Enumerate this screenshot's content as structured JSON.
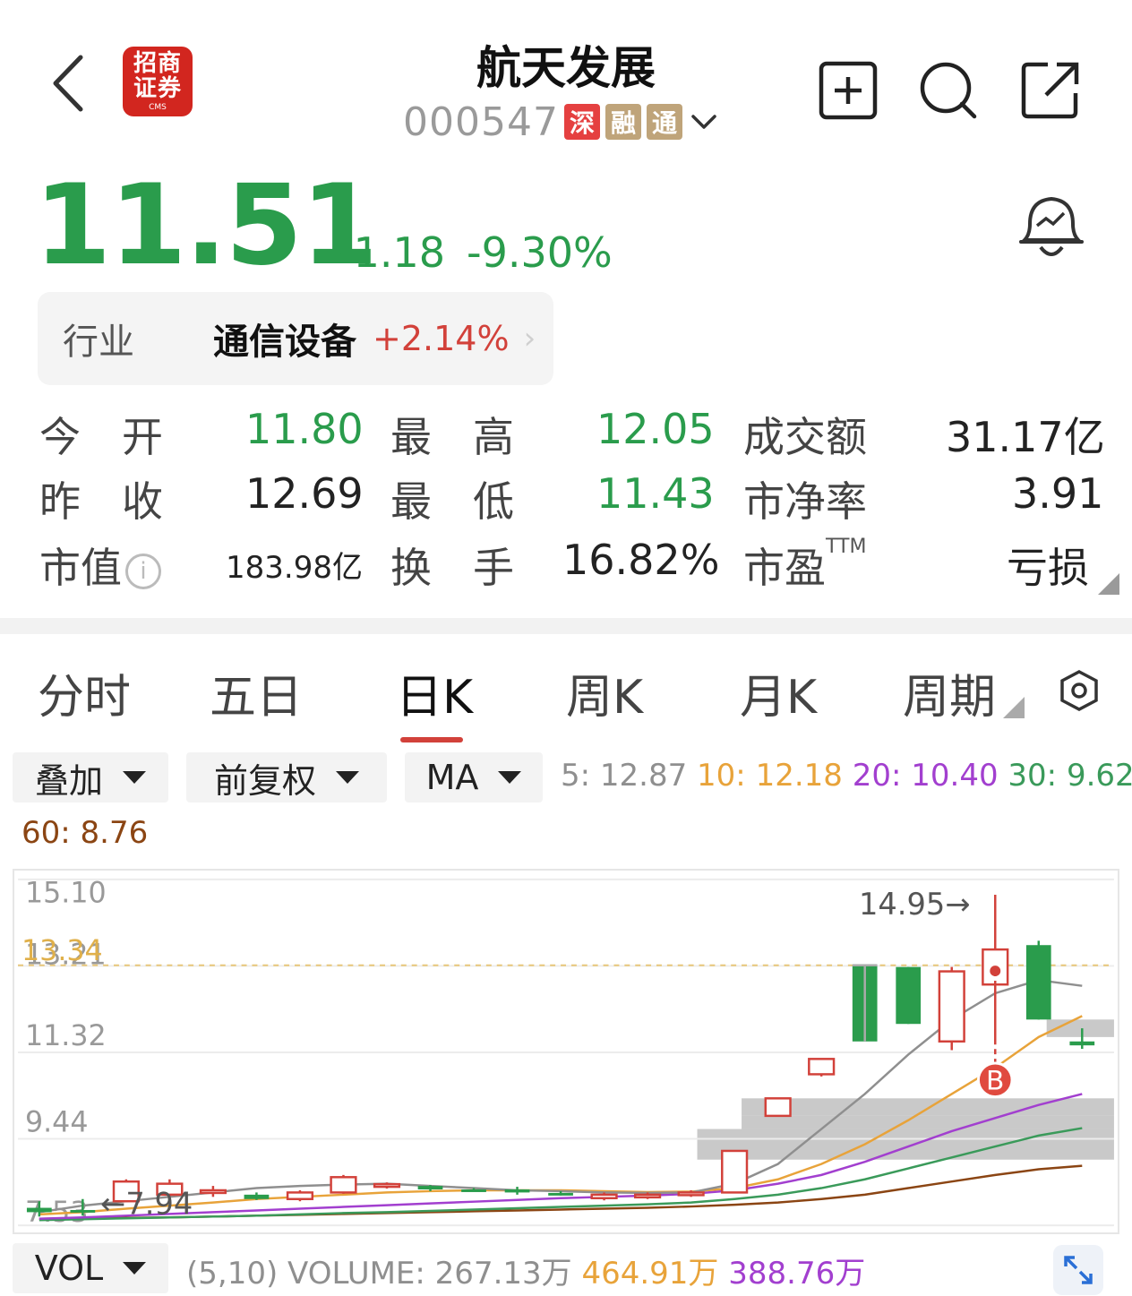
{
  "header": {
    "broker_logo_text": [
      "招商",
      "证券",
      "CMS"
    ],
    "stock_name": "航天发展",
    "stock_code": "000547",
    "badges": [
      "深",
      "融",
      "通"
    ]
  },
  "quote": {
    "price": "11.51",
    "change": "-1.18",
    "change_pct": "-9.30%"
  },
  "industry": {
    "label": "行业",
    "name": "通信设备",
    "change_pct": "+2.14%"
  },
  "stats": {
    "open_label": "今　开",
    "open": "11.80",
    "high_label": "最　高",
    "high": "12.05",
    "turnover_amt_label": "成交额",
    "turnover_amt": "31.17亿",
    "prev_close_label": "昨　收",
    "prev_close": "12.69",
    "low_label": "最　低",
    "low": "11.43",
    "pb_label": "市净率",
    "pb": "3.91",
    "mcap_label": "市值",
    "mcap": "183.98亿",
    "turnover_label": "换　手",
    "turnover": "16.82%",
    "pe_label": "市盈",
    "pe_sup": "TTM",
    "pe": "亏损"
  },
  "tabs": [
    "分时",
    "五日",
    "日K",
    "周K",
    "月K",
    "周期"
  ],
  "active_tab": "日K",
  "selectors": {
    "overlay": "叠加",
    "adjust": "前复权",
    "indicator": "MA",
    "vol": "VOL"
  },
  "ma": {
    "ma5": "5: 12.87",
    "ma10": "10: 12.18",
    "ma20": "20: 10.40",
    "ma30": "30: 9.62",
    "ma60": "60: 8.76"
  },
  "colors": {
    "up": "#d2413a",
    "down": "#2a9c4c",
    "ma5": "#8f8f8f",
    "ma10": "#e8a33a",
    "ma20": "#a23fcf",
    "ma30": "#3a9a5a",
    "ma60": "#8b4513"
  },
  "chart_data": {
    "type": "candlestick",
    "y_ticks": [
      "15.10",
      "13.21",
      "11.32",
      "9.44",
      "7.53"
    ],
    "ref_price_label": "13.34",
    "max_label": "14.95→",
    "min_label": "←7.94",
    "buy_marker": "B",
    "candles": [
      {
        "o": 7.8,
        "h": 7.95,
        "l": 7.6,
        "c": 7.7
      },
      {
        "o": 7.75,
        "h": 8.0,
        "l": 7.62,
        "c": 7.7
      },
      {
        "o": 7.95,
        "h": 8.45,
        "l": 7.94,
        "c": 8.4
      },
      {
        "o": 8.1,
        "h": 8.45,
        "l": 8.05,
        "c": 8.35
      },
      {
        "o": 8.2,
        "h": 8.3,
        "l": 8.05,
        "c": 8.2
      },
      {
        "o": 8.1,
        "h": 8.15,
        "l": 7.98,
        "c": 8.0
      },
      {
        "o": 8.0,
        "h": 8.2,
        "l": 7.95,
        "c": 8.15
      },
      {
        "o": 8.15,
        "h": 8.55,
        "l": 8.12,
        "c": 8.5
      },
      {
        "o": 8.28,
        "h": 8.38,
        "l": 8.24,
        "c": 8.34
      },
      {
        "o": 8.3,
        "h": 8.32,
        "l": 8.18,
        "c": 8.22
      },
      {
        "o": 8.22,
        "h": 8.25,
        "l": 8.17,
        "c": 8.2
      },
      {
        "o": 8.22,
        "h": 8.28,
        "l": 8.1,
        "c": 8.15
      },
      {
        "o": 8.14,
        "h": 8.18,
        "l": 8.08,
        "c": 8.12
      },
      {
        "o": 8.02,
        "h": 8.15,
        "l": 7.97,
        "c": 8.1
      },
      {
        "o": 8.05,
        "h": 8.15,
        "l": 8.0,
        "c": 8.1
      },
      {
        "o": 8.1,
        "h": 8.2,
        "l": 8.05,
        "c": 8.15
      },
      {
        "o": 8.15,
        "h": 9.1,
        "l": 8.14,
        "c": 9.1
      },
      {
        "o": 9.9,
        "h": 10.3,
        "l": 9.88,
        "c": 10.3
      },
      {
        "o": 10.85,
        "h": 11.2,
        "l": 10.8,
        "c": 11.2
      },
      {
        "o": 13.34,
        "h": 13.34,
        "l": 11.6,
        "c": 11.6
      },
      {
        "o": 13.3,
        "h": 13.3,
        "l": 12.0,
        "c": 12.0
      },
      {
        "o": 11.6,
        "h": 13.3,
        "l": 11.4,
        "c": 13.2
      },
      {
        "o": 12.9,
        "h": 14.95,
        "l": 11.6,
        "c": 13.7
      },
      {
        "o": 13.8,
        "h": 13.9,
        "l": 12.1,
        "c": 12.1
      },
      {
        "o": 11.6,
        "h": 11.9,
        "l": 11.43,
        "c": 11.51
      }
    ],
    "ma5": [
      7.7,
      7.85,
      7.95,
      8.05,
      8.15,
      8.25,
      8.3,
      8.33,
      8.35,
      8.3,
      8.25,
      8.2,
      8.18,
      8.15,
      8.14,
      8.15,
      8.35,
      8.8,
      9.6,
      10.4,
      11.3,
      12.1,
      12.7,
      13.0,
      12.87
    ],
    "ma10": [
      7.65,
      7.7,
      7.78,
      7.85,
      7.92,
      8.0,
      8.05,
      8.1,
      8.15,
      8.18,
      8.2,
      8.2,
      8.2,
      8.18,
      8.16,
      8.17,
      8.25,
      8.45,
      8.8,
      9.25,
      9.8,
      10.4,
      11.0,
      11.7,
      12.18
    ],
    "ma20": [
      7.55,
      7.58,
      7.62,
      7.66,
      7.7,
      7.74,
      7.78,
      7.82,
      7.86,
      7.9,
      7.94,
      7.98,
      8.02,
      8.05,
      8.08,
      8.12,
      8.2,
      8.35,
      8.55,
      8.85,
      9.2,
      9.55,
      9.85,
      10.15,
      10.4
    ],
    "ma30": [
      7.52,
      7.54,
      7.56,
      7.58,
      7.6,
      7.62,
      7.65,
      7.68,
      7.7,
      7.73,
      7.76,
      7.79,
      7.82,
      7.85,
      7.88,
      7.92,
      8.0,
      8.1,
      8.25,
      8.45,
      8.7,
      8.95,
      9.2,
      9.45,
      9.62
    ],
    "ma60": [
      7.55,
      7.56,
      7.57,
      7.58,
      7.6,
      7.62,
      7.64,
      7.66,
      7.68,
      7.7,
      7.72,
      7.74,
      7.76,
      7.78,
      7.8,
      7.83,
      7.87,
      7.92,
      8.0,
      8.1,
      8.25,
      8.4,
      8.55,
      8.68,
      8.76
    ],
    "ylim": [
      7.4,
      15.3
    ]
  },
  "volume": {
    "params": "(5,10) VOLUME: 267.13万",
    "ma5": "464.91万",
    "ma10": "388.76万"
  }
}
